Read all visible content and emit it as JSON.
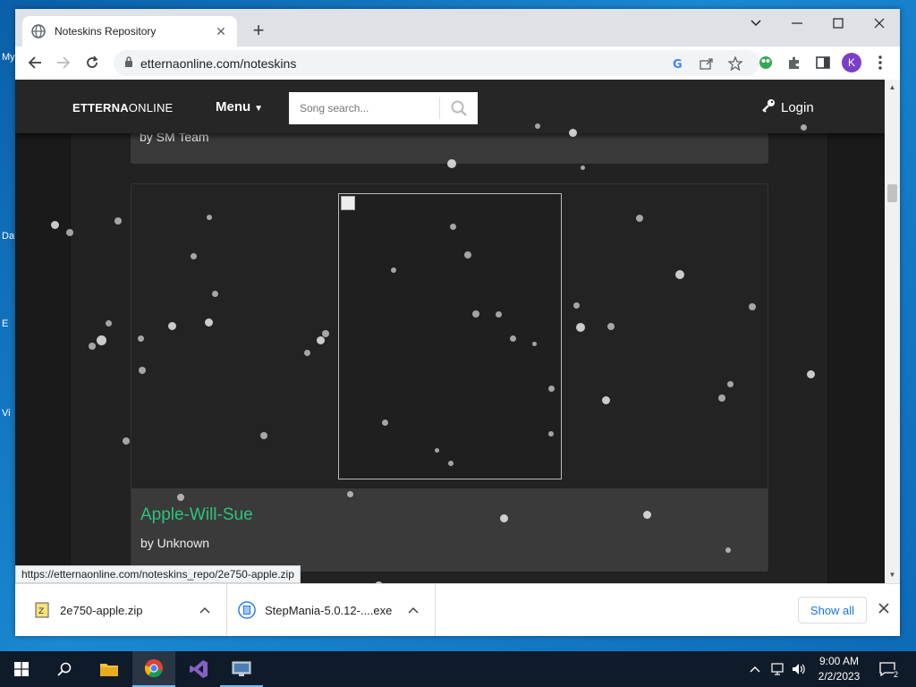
{
  "desktop": {
    "labels": [
      "My",
      "Da",
      "E",
      "Vi"
    ]
  },
  "browser": {
    "tab_title": "Noteskins Repository",
    "url": "etternaonline.com/noteskins",
    "status_url": "https://etternaonline.com/noteskins_repo/2e750-apple.zip",
    "profile_initial": "K"
  },
  "site": {
    "brand_bold": "ETTERNA",
    "brand_rest": "ONLINE",
    "menu_label": "Menu",
    "search_placeholder": "Song search...",
    "login_label": "Login",
    "prev_card_author": "by SM Team",
    "card_title": "Apple-Will-Sue",
    "card_author": "by Unknown",
    "accent_color": "#2ec27e"
  },
  "downloads": {
    "items": [
      {
        "name": "2e750-apple.zip",
        "icon": "zip-file-icon"
      },
      {
        "name": "StepMania-5.0.12-....exe",
        "icon": "installer-icon"
      }
    ],
    "show_all_label": "Show all"
  },
  "taskbar": {
    "time": "9:00 AM",
    "date": "2/2/2023",
    "notification_count": "2"
  }
}
